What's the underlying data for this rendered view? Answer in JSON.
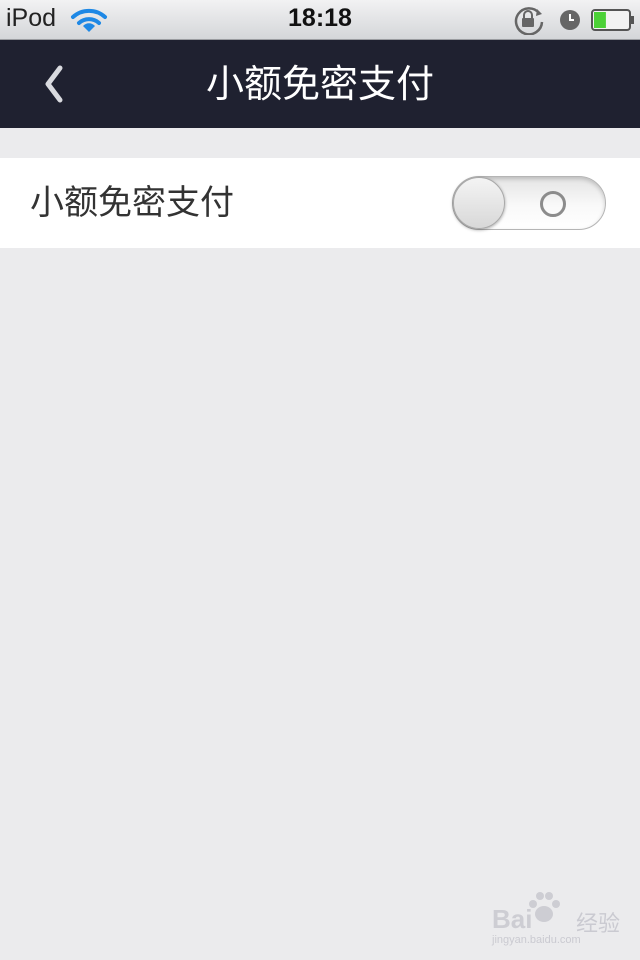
{
  "status_bar": {
    "carrier": "iPod",
    "time": "18:18",
    "icons": [
      "wifi-icon",
      "rotation-lock-icon",
      "alarm-icon",
      "battery-icon"
    ],
    "battery_level": 0.35,
    "battery_color": "#4cd137"
  },
  "nav": {
    "title": "小额免密支付",
    "back_icon": "chevron-left-icon",
    "background": "#1f2130"
  },
  "settings": {
    "rows": [
      {
        "label": "小额免密支付",
        "toggle_on": false
      }
    ]
  },
  "watermark": {
    "brand": "Bai",
    "brand_suffix": "经验",
    "url": "jingyan.baidu.com"
  }
}
